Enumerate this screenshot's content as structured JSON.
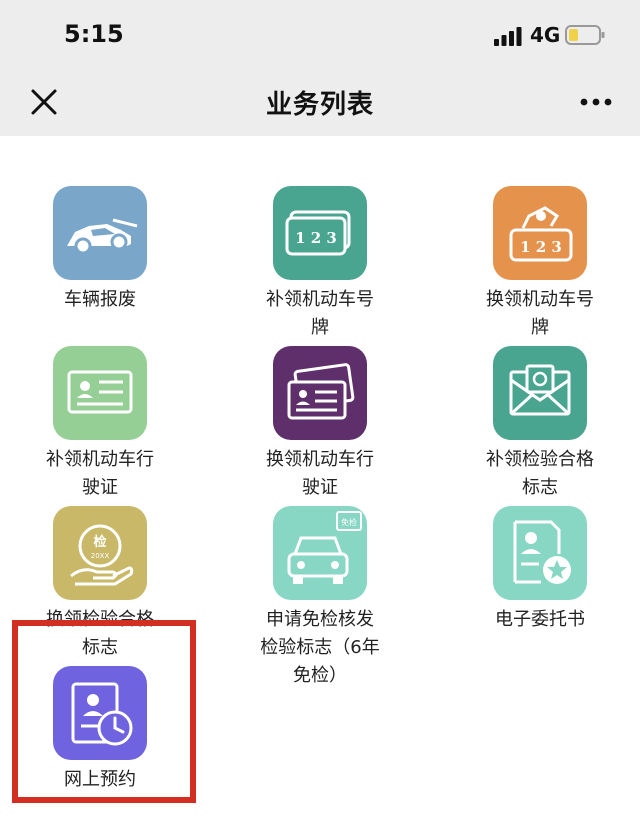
{
  "status_bar": {
    "time": "5:15",
    "network": "4G"
  },
  "nav": {
    "title": "业务列表",
    "close_icon": "close-icon",
    "more_icon": "more-icon"
  },
  "services": [
    {
      "label": "车辆报废",
      "color": "#79a6c9",
      "icon": "car-scrap-icon"
    },
    {
      "label": "补领机动车号\n牌",
      "color": "#49a58f",
      "icon": "license-plate-icon"
    },
    {
      "label": "换领机动车号\n牌",
      "color": "#e5924d",
      "icon": "plate-exchange-icon"
    },
    {
      "label": "补领机动车行\n驶证",
      "color": "#96cf96",
      "icon": "license-card-icon"
    },
    {
      "label": "换领机动车行\n驶证",
      "color": "#5e2f6a",
      "icon": "license-cards-icon"
    },
    {
      "label": "补领检验合格\n标志",
      "color": "#49a58f",
      "icon": "envelope-icon"
    },
    {
      "label": "换领检验合格\n标志",
      "color": "#c8b868",
      "icon": "inspection-badge-icon",
      "badge_text": "检",
      "badge_year": "20XX"
    },
    {
      "label": "申请免检核发\n检验标志（6年\n免检）",
      "color": "#88d6c4",
      "icon": "car-exempt-icon",
      "badge_text": "免检"
    },
    {
      "label": "电子委托书",
      "color": "#88d6c4",
      "icon": "certificate-star-icon"
    },
    {
      "label": "网上预约",
      "color": "#7063e0",
      "icon": "appointment-icon"
    }
  ],
  "plate_text": "1 2 3",
  "highlight_color": "#d22f22"
}
